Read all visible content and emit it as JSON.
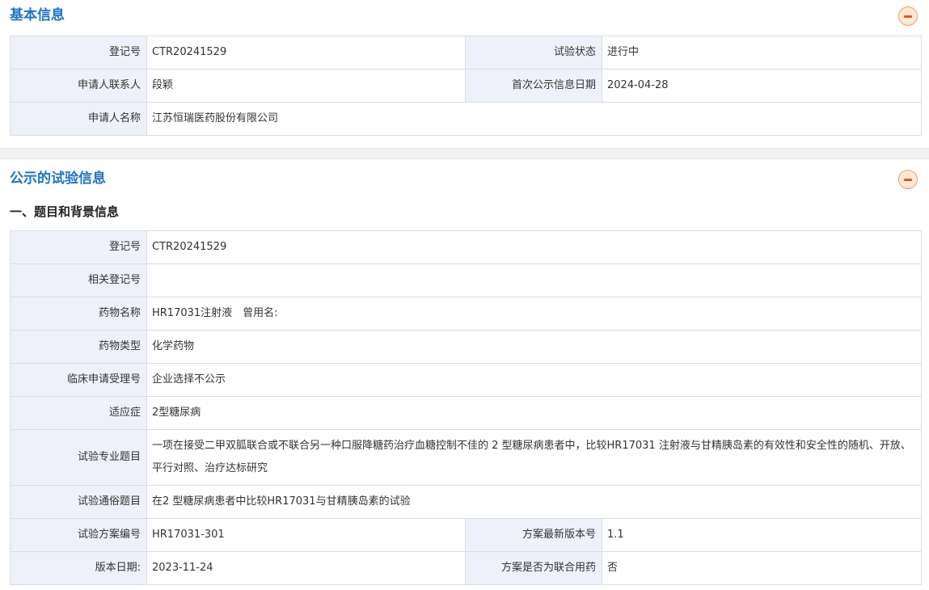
{
  "basic": {
    "title": "基本信息",
    "reg_no_label": "登记号",
    "reg_no": "CTR20241529",
    "status_label": "试验状态",
    "status": "进行中",
    "contact_label": "申请人联系人",
    "contact": "段颖",
    "first_pub_label": "首次公示信息日期",
    "first_pub": "2024-04-28",
    "applicant_label": "申请人名称",
    "applicant": "江苏恒瑞医药股份有限公司"
  },
  "trial": {
    "title": "公示的试验信息",
    "subtitle": "一、题目和背景信息",
    "rows": {
      "reg_no_label": "登记号",
      "reg_no": "CTR20241529",
      "related_label": "相关登记号",
      "related": "",
      "drug_name_label": "药物名称",
      "drug_name": "HR17031注射液　曾用名:",
      "drug_type_label": "药物类型",
      "drug_type": "化学药物",
      "accept_no_label": "临床申请受理号",
      "accept_no": "企业选择不公示",
      "indication_label": "适应症",
      "indication": "2型糖尿病",
      "pro_title_label": "试验专业题目",
      "pro_title": "一项在接受二甲双胍联合或不联合另一种口服降糖药治疗血糖控制不佳的 2 型糖尿病患者中，比较HR17031 注射液与甘精胰岛素的有效性和安全性的随机、开放、平行对照、治疗达标研究",
      "pop_title_label": "试验通俗题目",
      "pop_title": "在2 型糖尿病患者中比较HR17031与甘精胰岛素的试验",
      "protocol_no_label": "试验方案编号",
      "protocol_no": "HR17031-301",
      "version_label": "方案最新版本号",
      "version": "1.1",
      "version_date_label": "版本日期:",
      "version_date": "2023-11-24",
      "combo_label": "方案是否为联合用药",
      "combo": "否"
    }
  }
}
